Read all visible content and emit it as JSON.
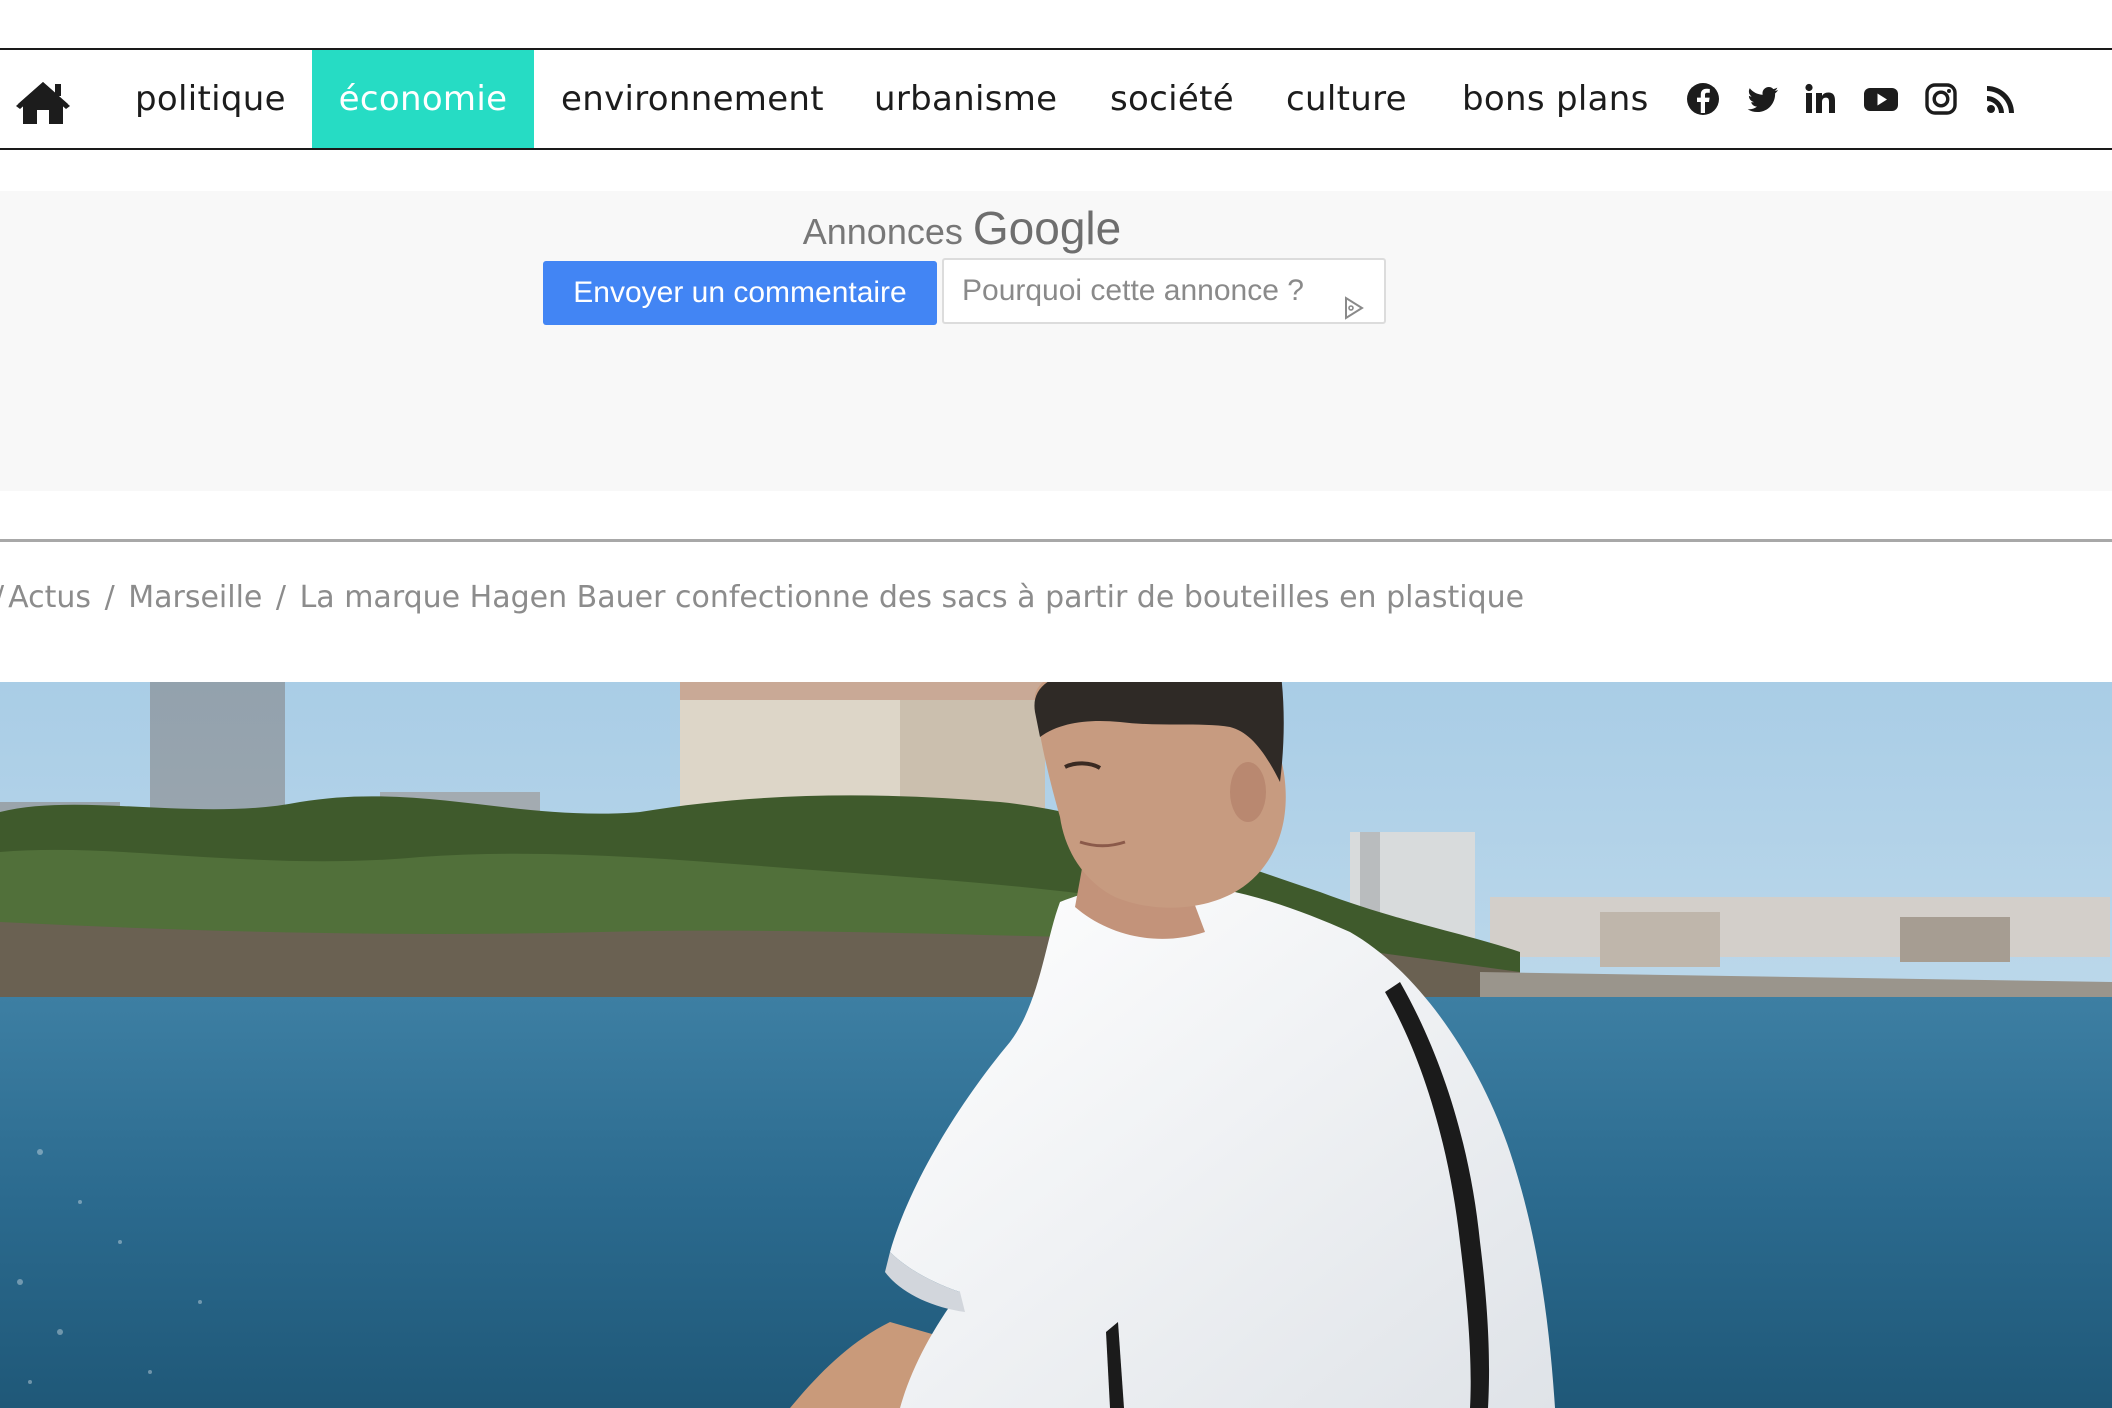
{
  "nav": {
    "home_icon": "home-icon",
    "items": [
      {
        "label": "politique",
        "active": false
      },
      {
        "label": "économie",
        "active": true
      },
      {
        "label": "environnement",
        "active": false
      },
      {
        "label": "urbanisme",
        "active": false
      },
      {
        "label": "société",
        "active": false
      },
      {
        "label": "culture",
        "active": false
      },
      {
        "label": "bons plans",
        "active": false
      }
    ],
    "social": [
      "facebook-icon",
      "twitter-icon",
      "linkedin-icon",
      "youtube-icon",
      "instagram-icon",
      "rss-icon"
    ],
    "active_color": "#26dcc4"
  },
  "ad": {
    "label_prefix": "Annonces",
    "label_brand": "Google",
    "feedback_button": "Envoyer un commentaire",
    "why_button": "Pourquoi cette annonce ?",
    "feedback_color": "#4285f4"
  },
  "breadcrumb": {
    "items": [
      "Actus",
      "Marseille",
      "La marque Hagen Bauer confectionne des sacs à partir de bouteilles en plastique"
    ]
  }
}
